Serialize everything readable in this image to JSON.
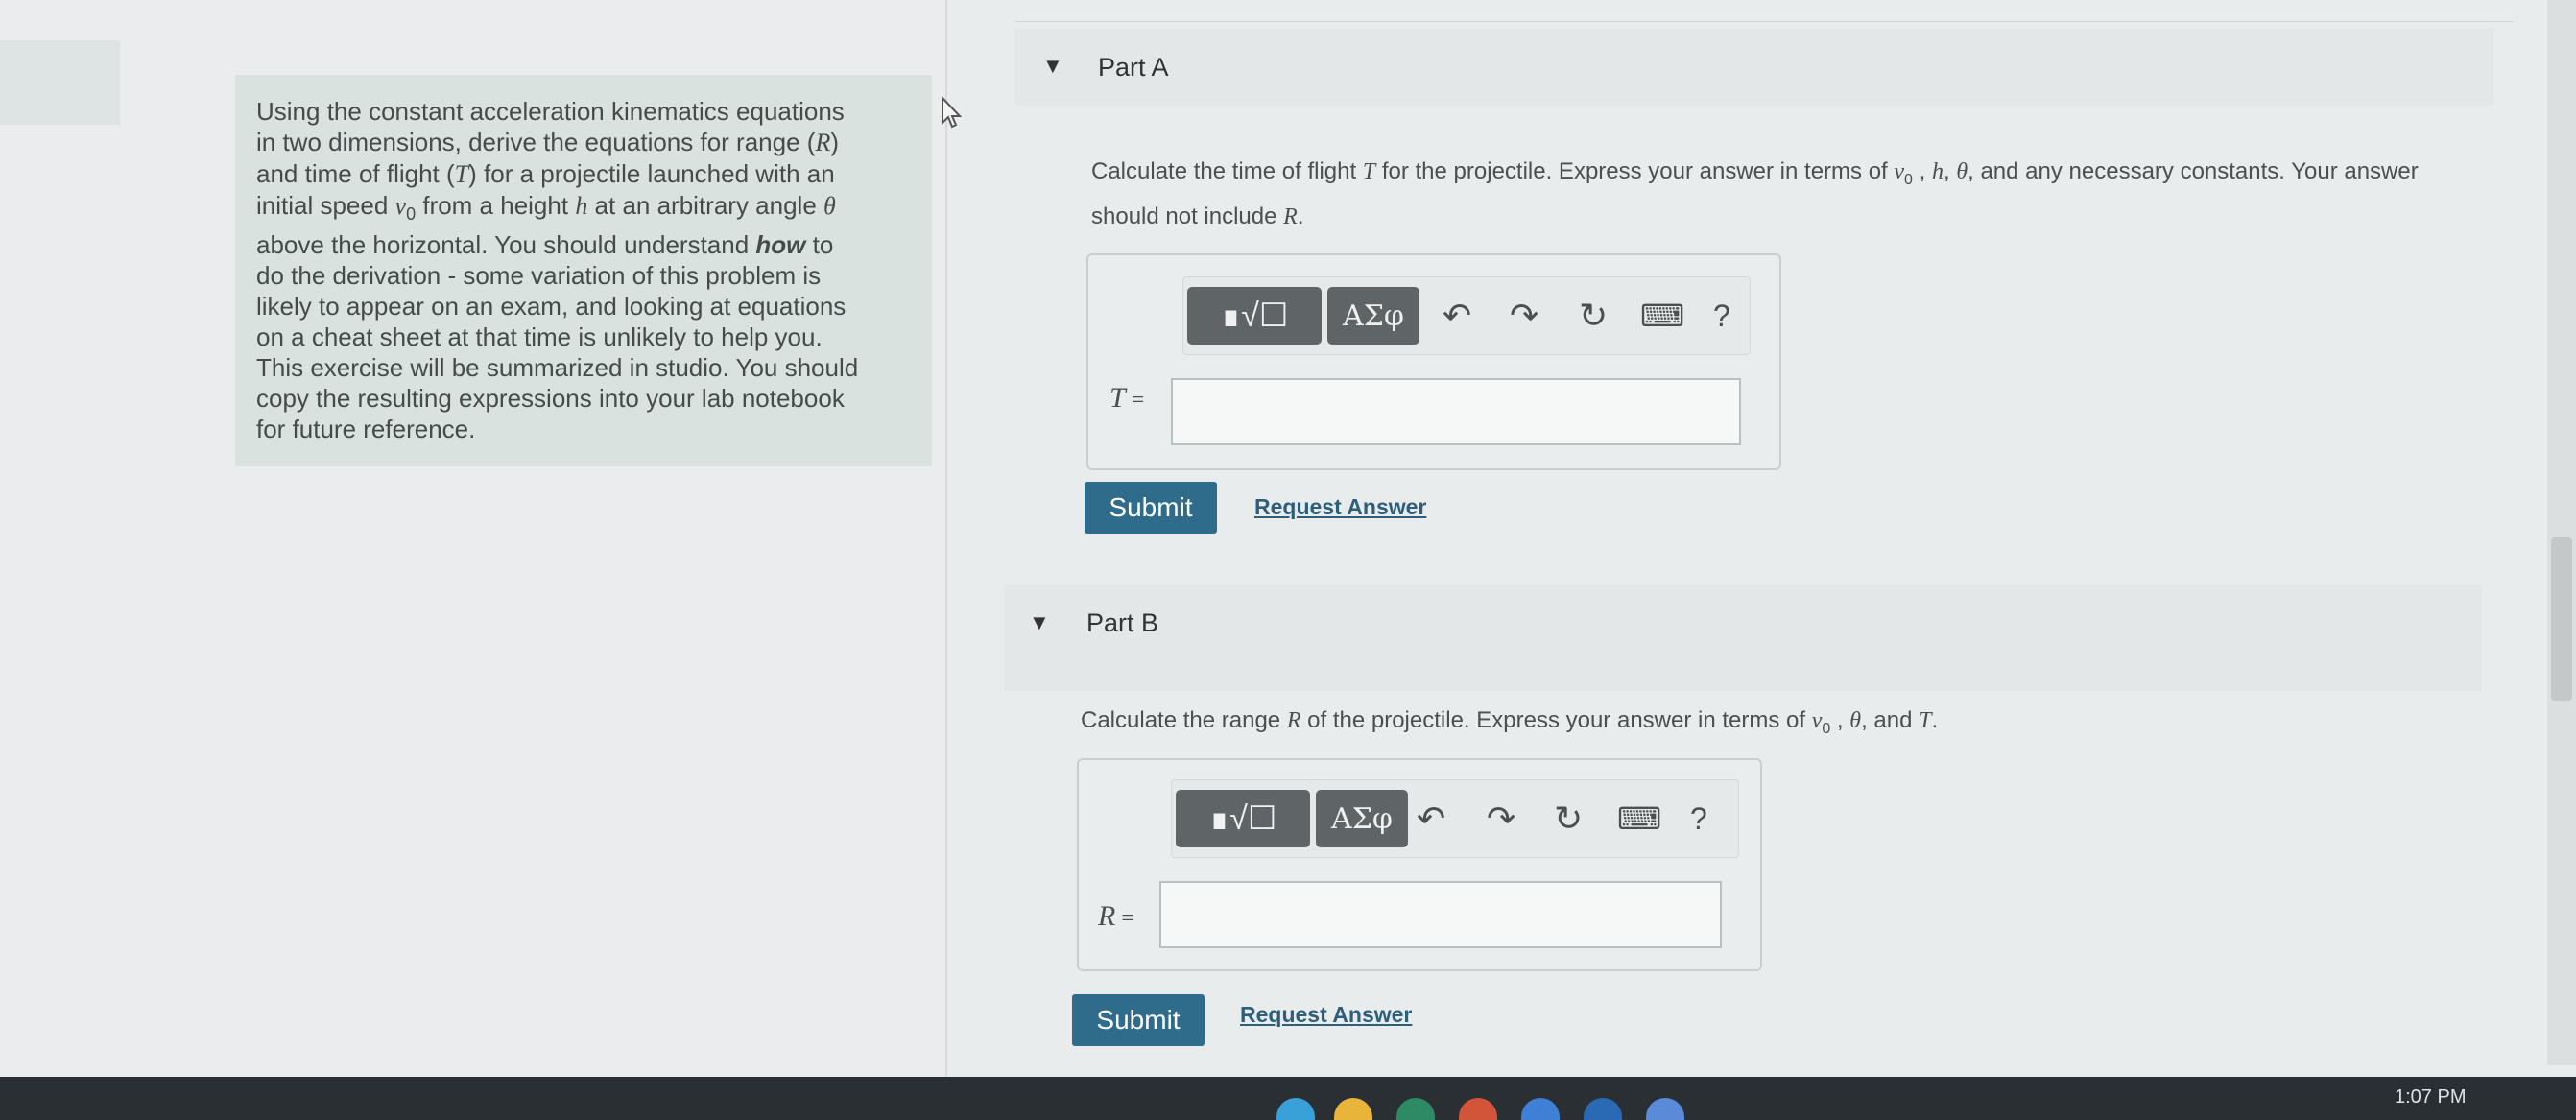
{
  "intro": {
    "l1": "Using the constant acceleration kinematics equations",
    "l2": "in two dimensions, derive the equations for range (",
    "l2v": "R",
    "l2e": ")",
    "l3": "and time of flight (",
    "l3v": "T",
    "l3e": ") for a projectile launched with an",
    "l4": "initial speed ",
    "l4v": "v",
    "l4s": "0",
    "l4m": " from a height ",
    "l4h": "h",
    "l4e": " at an arbitrary angle ",
    "l4t": "θ",
    "l5": "above the horizontal. You should understand ",
    "l5b": "how",
    "l5e": " to",
    "l6": "do the derivation - some variation of this problem is",
    "l7": "likely to appear on an exam, and looking at equations",
    "l8": "on a cheat sheet at that time is unlikely to help you.",
    "l9": "This exercise will be summarized in studio. You should",
    "l10": "copy the resulting expressions into your lab notebook",
    "l11": "for future reference."
  },
  "partA": {
    "title": "Part A",
    "q1": "Calculate the time of flight ",
    "q1v": "T",
    "q1b": " for the projectile. Express your answer in terms of ",
    "q1v0": "v",
    "q1s": "0",
    "q1c": " , ",
    "q1h": "h",
    "q1c2": ", ",
    "q1t": "θ",
    "q1e": ", and any necessary constants. Your answer",
    "q2": "should not include ",
    "q2v": "R",
    "q2e": ".",
    "label": "T",
    "eq": " =",
    "submit": "Submit",
    "request": "Request Answer"
  },
  "partB": {
    "title": "Part B",
    "q1": "Calculate the range ",
    "q1v": "R",
    "q1b": " of the projectile. Express your answer in terms of ",
    "q1v0": "v",
    "q1s": "0",
    "q1c": " , ",
    "q1t": "θ",
    "q1e": ", and ",
    "q1T": "T",
    "q1end": ".",
    "label": "R",
    "eq": " =",
    "submit": "Submit",
    "request": "Request Answer"
  },
  "toolbar": {
    "templates": "∎√☐",
    "greek": "ΑΣφ",
    "undo": "↶",
    "redo": "↷",
    "reset": "↻",
    "keyboard": "⌨",
    "help": "?"
  },
  "taskbar": {
    "clock": "1:07 PM"
  },
  "icons": {
    "triangle": "▼",
    "cursor": "arrow-cursor-icon"
  }
}
